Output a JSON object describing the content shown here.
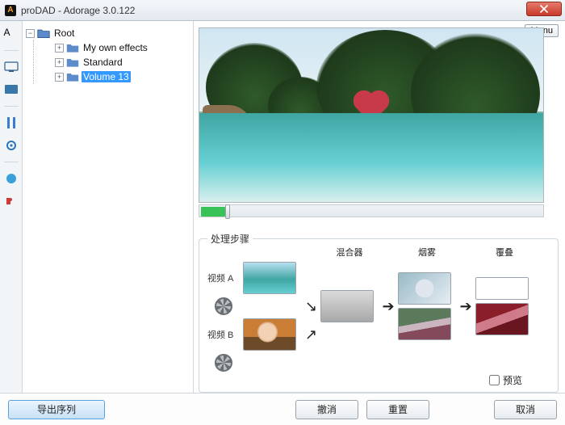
{
  "window": {
    "title": "proDAD - Adorage 3.0.122"
  },
  "topright": {
    "menu_label": "Menu"
  },
  "tree": {
    "root": "Root",
    "items": [
      {
        "label": "My own effects"
      },
      {
        "label": "Standard"
      },
      {
        "label": "Volume 13",
        "selected": true
      }
    ]
  },
  "steps": {
    "legend": "处理步骤",
    "video_a": "视频 A",
    "video_b": "视频 B",
    "mixer": "混合器",
    "smoke": "烟雾",
    "overlay": "覆叠",
    "preview_checkbox": "预览"
  },
  "footer": {
    "export_sequence": "导出序列",
    "undo": "撤消",
    "reset": "重置",
    "cancel": "取消"
  },
  "colors": {
    "selection": "#3399ff",
    "close": "#c83a2a"
  }
}
